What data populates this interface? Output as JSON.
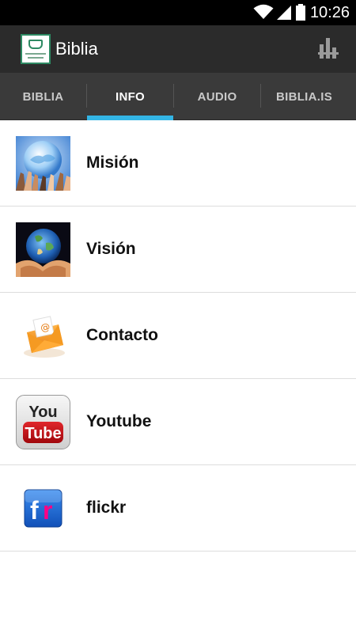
{
  "status_bar": {
    "time": "10:26",
    "icons": [
      "wifi-icon",
      "signal-icon",
      "battery-icon"
    ]
  },
  "action_bar": {
    "title": "Biblia",
    "logo": "app-logo-icon",
    "menu_icon": "overflow-icon"
  },
  "tabs": [
    {
      "label": "BIBLIA",
      "active": false
    },
    {
      "label": "INFO",
      "active": true
    },
    {
      "label": "AUDIO",
      "active": false
    },
    {
      "label": "BIBLIA.IS",
      "active": false
    }
  ],
  "colors": {
    "accent": "#33b5e5",
    "action_bar_bg": "#2b2b2b",
    "tab_bar_bg": "#3a3a3a"
  },
  "list": [
    {
      "label": "Misión",
      "icon": "hands-globe-icon"
    },
    {
      "label": "Visión",
      "icon": "earth-in-hands-icon"
    },
    {
      "label": "Contacto",
      "icon": "email-envelope-icon"
    },
    {
      "label": "Youtube",
      "icon": "youtube-icon"
    },
    {
      "label": "flickr",
      "icon": "flickr-icon"
    }
  ]
}
